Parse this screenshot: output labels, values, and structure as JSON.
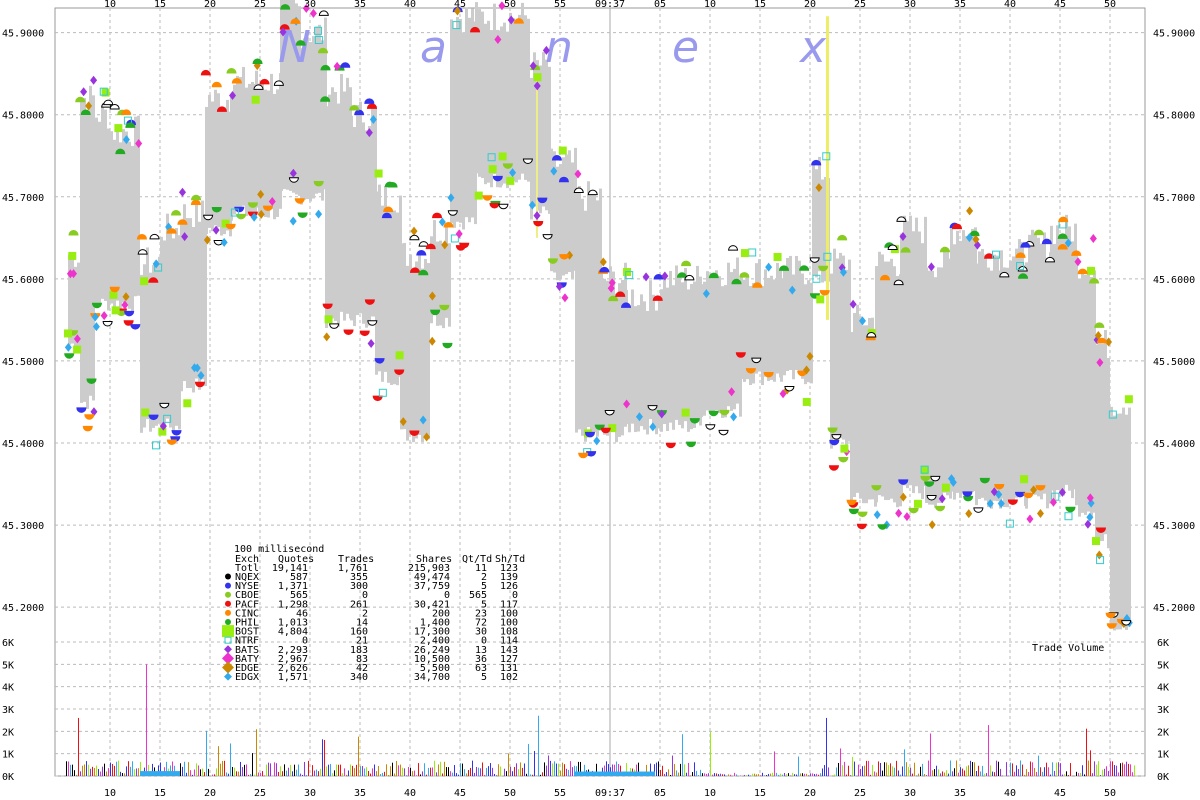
{
  "watermark": [
    "N",
    "a",
    "n",
    "e",
    "x"
  ],
  "colors": {
    "NQEX": "#000000",
    "NYSE": "#3333ee",
    "CBOE": "#88cc22",
    "PACF": "#ee1111",
    "CINC": "#ff8800",
    "PHIL": "#22aa22",
    "BOST": "#99ee11",
    "NTRF": "#33cccc",
    "BATS": "#9933dd",
    "BATY": "#ee33cc",
    "EDGE": "#cc8800",
    "EDGX": "#33aaee",
    "band": "#cccccc",
    "grid": "#bbbbbb"
  },
  "chart_data": {
    "type": "scatter",
    "title": "",
    "price_axis": {
      "ylim": [
        45.16,
        45.93
      ],
      "ticks": [
        "45.2000",
        "45.3000",
        "45.4000",
        "45.5000",
        "45.6000",
        "45.7000",
        "45.8000",
        "45.9000"
      ]
    },
    "x_ticks": [
      "10",
      "15",
      "20",
      "25",
      "30",
      "35",
      "40",
      "45",
      "50",
      "55",
      "09:37",
      "05",
      "10",
      "15",
      "20",
      "25",
      "30",
      "35",
      "40",
      "45",
      "50"
    ],
    "volume_axis": {
      "label": "Trade Volume",
      "ticks": [
        "0K",
        "1K",
        "2K",
        "3K",
        "4K",
        "5K",
        "6K"
      ],
      "ylim": [
        0,
        6000
      ]
    },
    "summary": {
      "interval": "100 millisecond",
      "headers": [
        "Exch",
        "Quotes",
        "Trades",
        "Shares",
        "Qt/Td",
        "Sh/Td"
      ],
      "total": [
        "Totl",
        "19,141",
        "1,761",
        "215,903",
        "11",
        "123"
      ],
      "rows": [
        {
          "exch": "NQEX",
          "quotes": "587",
          "trades": "355",
          "shares": "49,474",
          "qt_td": "2",
          "sh_td": "139"
        },
        {
          "exch": "NYSE",
          "quotes": "1,371",
          "trades": "300",
          "shares": "37,759",
          "qt_td": "5",
          "sh_td": "126"
        },
        {
          "exch": "CBOE",
          "quotes": "565",
          "trades": "0",
          "shares": "0",
          "qt_td": "565",
          "sh_td": "0"
        },
        {
          "exch": "PACF",
          "quotes": "1,298",
          "trades": "261",
          "shares": "30,421",
          "qt_td": "5",
          "sh_td": "117"
        },
        {
          "exch": "CINC",
          "quotes": "46",
          "trades": "2",
          "shares": "200",
          "qt_td": "23",
          "sh_td": "100"
        },
        {
          "exch": "PHIL",
          "quotes": "1,013",
          "trades": "14",
          "shares": "1,400",
          "qt_td": "72",
          "sh_td": "100"
        },
        {
          "exch": "BOST",
          "quotes": "4,804",
          "trades": "160",
          "shares": "17,300",
          "qt_td": "30",
          "sh_td": "108"
        },
        {
          "exch": "NTRF",
          "quotes": "0",
          "trades": "21",
          "shares": "2,400",
          "qt_td": "0",
          "sh_td": "114"
        },
        {
          "exch": "BATS",
          "quotes": "2,293",
          "trades": "183",
          "shares": "26,249",
          "qt_td": "13",
          "sh_td": "143"
        },
        {
          "exch": "BATY",
          "quotes": "2,967",
          "trades": "83",
          "shares": "10,500",
          "qt_td": "36",
          "sh_td": "127"
        },
        {
          "exch": "EDGE",
          "quotes": "2,626",
          "trades": "42",
          "shares": "5,500",
          "qt_td": "63",
          "sh_td": "131"
        },
        {
          "exch": "EDGX",
          "quotes": "1,571",
          "trades": "340",
          "shares": "34,700",
          "qt_td": "5",
          "sh_td": "102"
        }
      ]
    }
  }
}
